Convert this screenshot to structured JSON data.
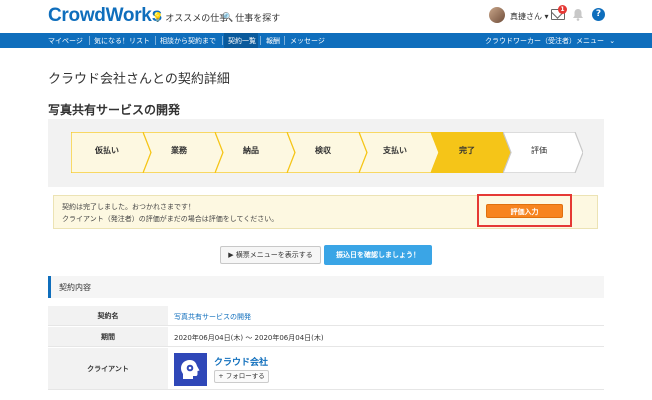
{
  "header": {
    "logo": "CrowdWorks",
    "nav_recommend": "オススメの仕事",
    "nav_find": "仕事を探す",
    "username": "真捷さん ▾",
    "mail_badge": "1",
    "help": "?"
  },
  "navbar": {
    "items": [
      "マイページ",
      "気になる！リスト",
      "相談から契約まで",
      "契約一覧",
      "報酬",
      "メッセージ"
    ],
    "active_item": "契約一覧",
    "right_menu": "クラウドワーカー（受注者）メニュー"
  },
  "page": {
    "title": "クラウド会社さんとの契約詳細",
    "job_title": "写真共有サービスの開発"
  },
  "steps": [
    {
      "label": "仮払い",
      "state": "done"
    },
    {
      "label": "業務",
      "state": "done"
    },
    {
      "label": "納品",
      "state": "done"
    },
    {
      "label": "検収",
      "state": "done"
    },
    {
      "label": "支払い",
      "state": "done"
    },
    {
      "label": "完了",
      "state": "current"
    },
    {
      "label": "評価",
      "state": "todo"
    }
  ],
  "notice": {
    "line1": "契約は完了しました。おつかれさまです！",
    "line2": "クライアント（発注者）の評価がまだの場合は評価をしてください。",
    "eval_button": "評価入力"
  },
  "buttons": {
    "menu": "▶ 横票メニューを表示する",
    "confirm": "振込日を確認しましょう！"
  },
  "section": {
    "title": "契約内容"
  },
  "contract": {
    "name_label": "契約名",
    "name_value": "写真共有サービスの開発",
    "period_label": "期間",
    "period_value": "2020年06月04日(木) 〜 2020年06月04日(木)",
    "client_label": "クライアント",
    "client_name": "クラウド会社",
    "follow_button": "+ フォローする"
  },
  "colors": {
    "brand": "#0f6ebc",
    "step_done_fill": "#fdf8e1",
    "step_done_border": "#f5c518",
    "step_current": "#f5c518",
    "eval_button": "#f7841f",
    "highlight": "#e53935",
    "confirm_button": "#3aa5e6"
  }
}
